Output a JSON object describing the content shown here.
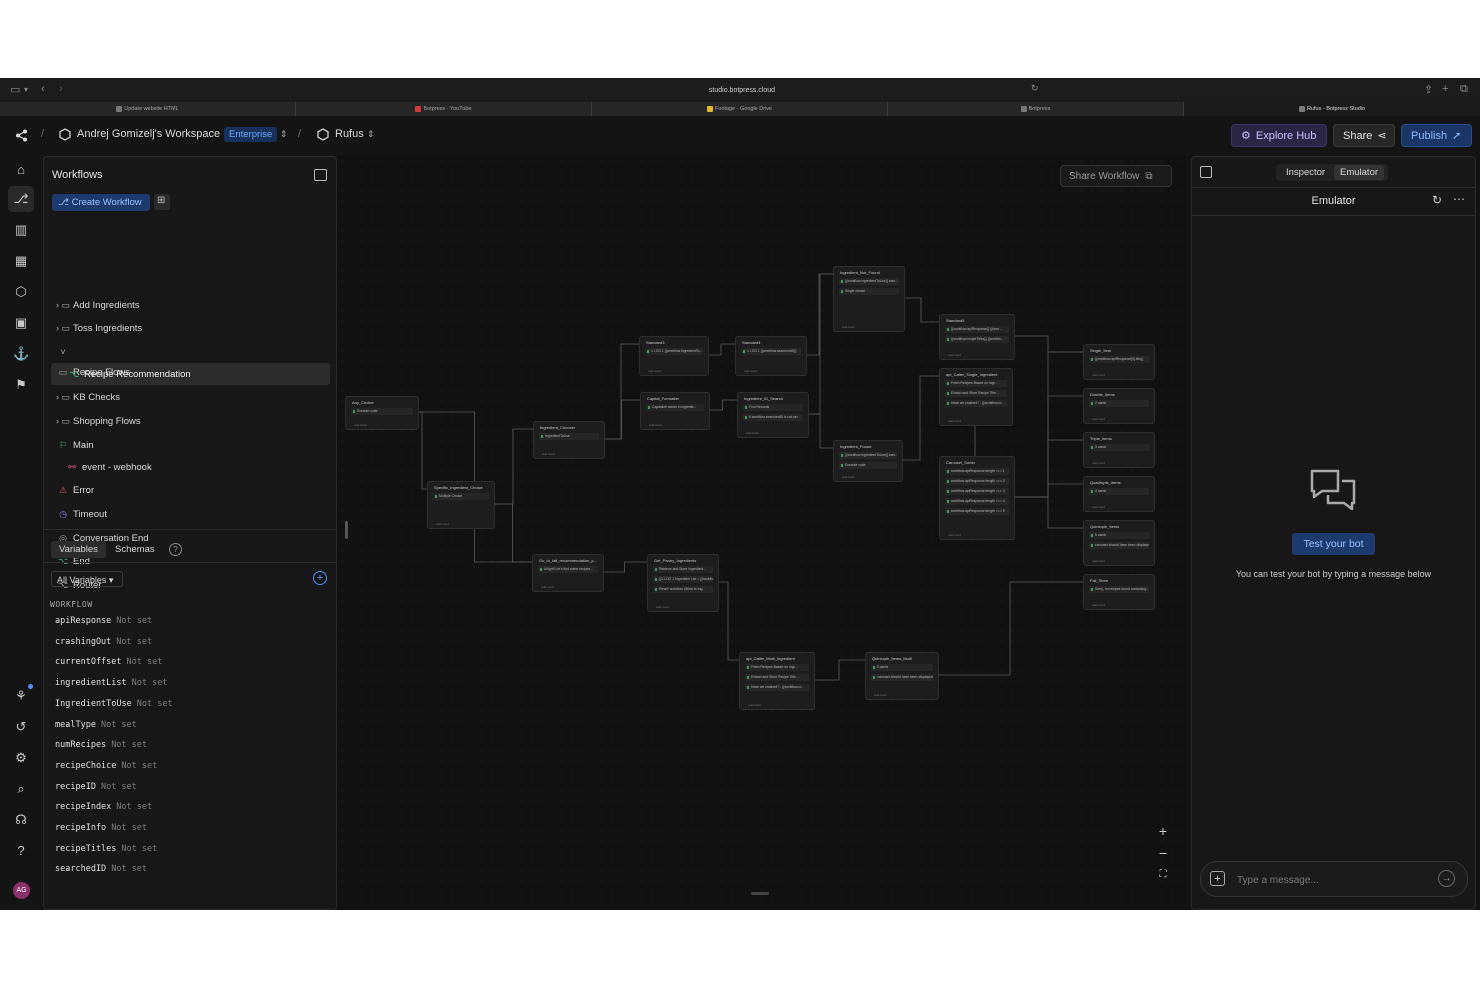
{
  "browser": {
    "url": "studio.botpress.cloud",
    "tabs": [
      {
        "label": "Update website HTML"
      },
      {
        "label": "Botpress - YouTube"
      },
      {
        "label": "Footage - Google Drive"
      },
      {
        "label": "Botpress"
      },
      {
        "label": "Rufus - Botpress Studio"
      }
    ]
  },
  "header": {
    "workspace": "Andrej Gomizelj's Workspace",
    "plan_badge": "Enterprise",
    "bot": "Rufus",
    "explore_hub": "Explore Hub",
    "share": "Share",
    "publish": "Publish"
  },
  "workflows": {
    "title": "Workflows",
    "create_button": "Create Workflow",
    "items": [
      {
        "label": "Add Ingredients",
        "icon": "folder-icon"
      },
      {
        "label": "Toss Ingredients",
        "icon": "folder-icon"
      },
      {
        "label": "Recipe Flows",
        "icon": "folder-icon"
      },
      {
        "label": "Recipe Recommendation",
        "icon": "flow-icon"
      },
      {
        "label": "KB Checks",
        "icon": "folder-icon"
      },
      {
        "label": "Shopping Flows",
        "icon": "folder-icon"
      },
      {
        "label": "Main",
        "icon": "flag-icon"
      },
      {
        "label": "event - webhook",
        "icon": "webhook-icon"
      },
      {
        "label": "Error",
        "icon": "warning-icon"
      },
      {
        "label": "Timeout",
        "icon": "clock-icon"
      },
      {
        "label": "Conversation End",
        "icon": "stop-icon"
      },
      {
        "label": "End",
        "icon": "flow-icon"
      },
      {
        "label": "Router",
        "icon": "flow-icon"
      }
    ]
  },
  "variables": {
    "tab_variables": "Variables",
    "tab_schemas": "Schemas",
    "filter": "All Variables",
    "section": "WORKFLOW",
    "not_set": "Not set",
    "list": [
      "apiResponse",
      "crashingOut",
      "currentOffset",
      "ingredientList",
      "IngredientToUse",
      "mealType",
      "numRecipes",
      "recipeChoice",
      "recipeID",
      "recipeIndex",
      "recipeInfo",
      "recipeTitles",
      "searchedID"
    ]
  },
  "canvas": {
    "share_workflow": "Share Workflow",
    "add_card": "Add Card",
    "nodes": [
      {
        "title": "Any_Choice",
        "cards": [
          "Execute code"
        ]
      },
      {
        "title": "Specific_Ingredient_Choice",
        "cards": [
          "Multiple Choice"
        ]
      },
      {
        "title": "Ingredient_Chooser",
        "cards": [
          "IngredientToUse"
        ]
      },
      {
        "title": "Standard3",
        "cards": [
          "1 LOG 1 {{workflow.ingredientTo..."
        ]
      },
      {
        "title": "Standard4",
        "cards": [
          "1 LOG 1 {{workflow.searchedID}}"
        ]
      },
      {
        "title": "Capital_Formatter",
        "cards": [
          "Capitalize words in ingredie..."
        ]
      },
      {
        "title": "Ingredient_ID_Search",
        "cards": [
          "Find Records",
          "If workflow.searchedID is not set"
        ]
      },
      {
        "title": "Ingredient_Not_Found",
        "cards": [
          "{{workflow.ingredientToUse}} was...",
          "Single choice"
        ]
      },
      {
        "title": "Ingredient_Found",
        "cards": [
          "{{workflow.ingredientToUse}} was...",
          "Execute code"
        ]
      },
      {
        "title": "Standard5",
        "cards": [
          "{{workflow.apiResponse}} {{num...",
          "{{workflow.recipeTitles}} {{workflo..."
        ]
      },
      {
        "title": "api_Caller_Single_Ingredient",
        "cards": [
          "Fetch Recipes Based on Ingr...",
          "Extract and Store Recipe Title...",
          "Have we crashed? - {{workflow.cr..."
        ]
      },
      {
        "title": "Carousel_Sorter",
        "cards": [
          "workflow.apiResponse.length === 1",
          "workflow.apiResponse.length === 2",
          "workflow.apiResponse.length === 3",
          "workflow.apiResponse.length === 4",
          "workflow.apiResponse.length === 5"
        ]
      },
      {
        "title": "Single_Item",
        "cards": [
          "{{workflow.apiResponse[0].title}}"
        ]
      },
      {
        "title": "Double_Items",
        "cards": [
          "2 cards"
        ]
      },
      {
        "title": "Triple_Items",
        "cards": [
          "3 cards"
        ]
      },
      {
        "title": "Quadruple_Items",
        "cards": [
          "4 cards"
        ]
      },
      {
        "title": "Quintuple_Items",
        "cards": [
          "5 cards",
          "carousel should have been displayed"
        ]
      },
      {
        "title": "Fail_Store",
        "cards": [
          "Sorry, no recipes found containing..."
        ]
      },
      {
        "title": "Go_to_fail_recommendation_p...",
        "cards": [
          "Alright! Let's find some recipes..."
        ]
      },
      {
        "title": "Get_Pantry_Ingredients",
        "cards": [
          "Retrieve and Store Ingredient...",
          "{{1 LOG 1 Ingredient List = {{workflo...",
          "Reset: workflow (What to trig..."
        ]
      },
      {
        "title": "api_Caller_Multi_Ingredient",
        "cards": [
          "Fetch Recipes Based on Ingr...",
          "Extract and Store Recipe Title...",
          "Have we crashed? - {{workflow.cr..."
        ]
      },
      {
        "title": "Quintuple_Items_Multi",
        "cards": [
          "5 cards",
          "carousel should have been displayed"
        ]
      }
    ]
  },
  "inspector": {
    "tab_inspector": "Inspector",
    "tab_emulator": "Emulator",
    "title": "Emulator",
    "test_button": "Test your bot",
    "hint": "You can test your bot by typing a message below",
    "placeholder": "Type a message..."
  },
  "colors": {
    "accent": "#4f8dff",
    "hub": "#c9bfff"
  }
}
